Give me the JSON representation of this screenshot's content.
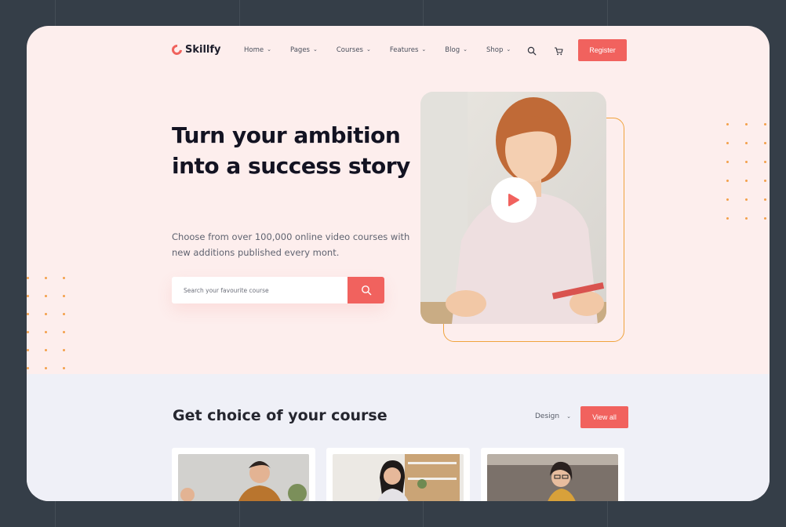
{
  "brand": {
    "name": "Skillfy",
    "accent": "#f1625e",
    "secondary_accent": "#f0a33d"
  },
  "nav": {
    "items": [
      {
        "label": "Home",
        "icon": "chevron-down-icon"
      },
      {
        "label": "Pages",
        "icon": "chevron-down-icon"
      },
      {
        "label": "Courses",
        "icon": "chevron-down-icon"
      },
      {
        "label": "Features",
        "icon": "chevron-down-icon"
      },
      {
        "label": "Blog",
        "icon": "chevron-down-icon"
      },
      {
        "label": "Shop",
        "icon": "chevron-down-icon"
      }
    ],
    "search_icon": "search-icon",
    "cart_icon": "cart-icon",
    "register_label": "Register"
  },
  "hero": {
    "title": "Turn your ambition into a success story",
    "subtitle": "Choose from over 100,000 online video courses with new additions published every mont.",
    "search_placeholder": "Search your favourite course",
    "search_button_icon": "search-icon",
    "play_icon": "play-icon"
  },
  "courses": {
    "title": "Get choice of your course",
    "filter_value": "Design",
    "view_all_label": "View all"
  }
}
